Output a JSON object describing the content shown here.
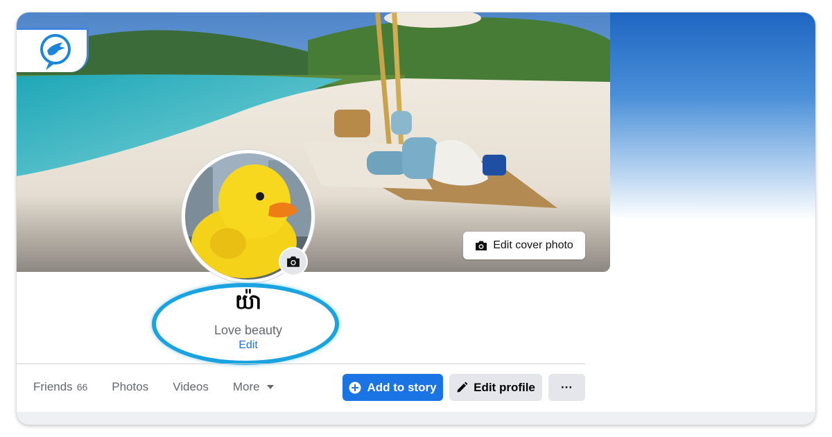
{
  "cover": {
    "edit_cover_label": "Edit cover photo",
    "camera_icon": "camera-icon"
  },
  "profile": {
    "name": "យ៉ា",
    "bio": "Love beauty",
    "bio_edit_label": "Edit"
  },
  "tabs": [
    {
      "label": "Friends",
      "count": "66"
    },
    {
      "label": "Photos"
    },
    {
      "label": "Videos"
    },
    {
      "label": "More",
      "icon": "caret-down-icon"
    }
  ],
  "actions": {
    "add_story_label": "Add to story",
    "add_story_icon": "plus-circle-icon",
    "edit_profile_label": "Edit profile",
    "edit_profile_icon": "pencil-icon",
    "more_label": "···"
  },
  "colors": {
    "primary_blue": "#1b74e4",
    "highlight_ring": "#1aa3e0",
    "secondary_button": "#e4e6eb",
    "muted_text": "#65676b"
  }
}
